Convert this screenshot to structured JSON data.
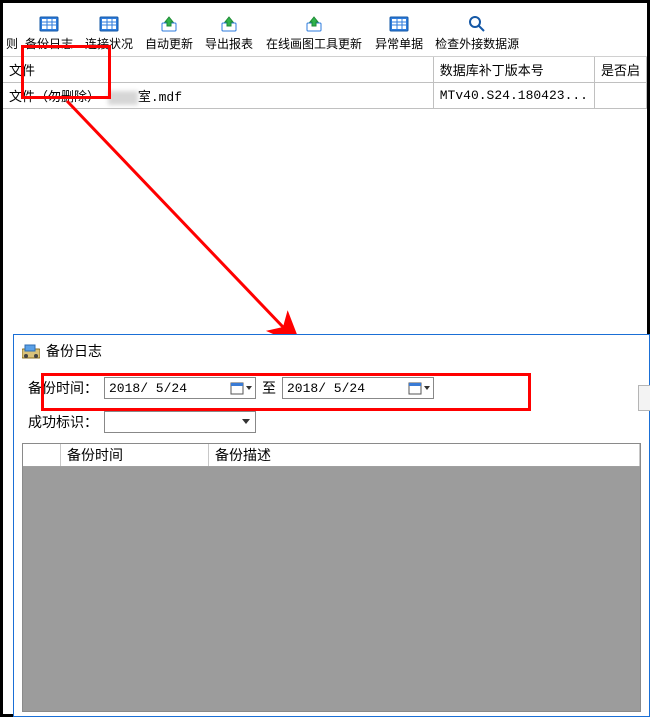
{
  "toolbar": {
    "partial_left": "则",
    "items": [
      {
        "label": "备份日志",
        "icon": "grid-icon"
      },
      {
        "label": "连接状况",
        "icon": "grid-icon"
      },
      {
        "label": "自动更新",
        "icon": "upload-icon"
      },
      {
        "label": "导出报表",
        "icon": "upload-icon"
      },
      {
        "label": "在线画图工具更新",
        "icon": "upload-icon"
      },
      {
        "label": "异常单据",
        "icon": "grid-icon"
      },
      {
        "label": "检查外接数据源",
        "icon": "search-icon"
      }
    ]
  },
  "grid_top": {
    "headers": {
      "file": "文件",
      "patch": "数据库补丁版本号",
      "enable": "是否启"
    },
    "row": {
      "file_prefix": "文件（勿删除）",
      "file_suffix": "室.mdf",
      "patch": "MTv40.S24.180423..."
    }
  },
  "dialog": {
    "title": "备份日志",
    "filters": {
      "time_label": "备份时间：",
      "date_from": "2018/ 5/24",
      "to_label": "至",
      "date_to": "2018/ 5/24",
      "flag_label": "成功标识："
    },
    "grid_headers": {
      "time": "备份时间",
      "desc": "备份描述"
    }
  }
}
